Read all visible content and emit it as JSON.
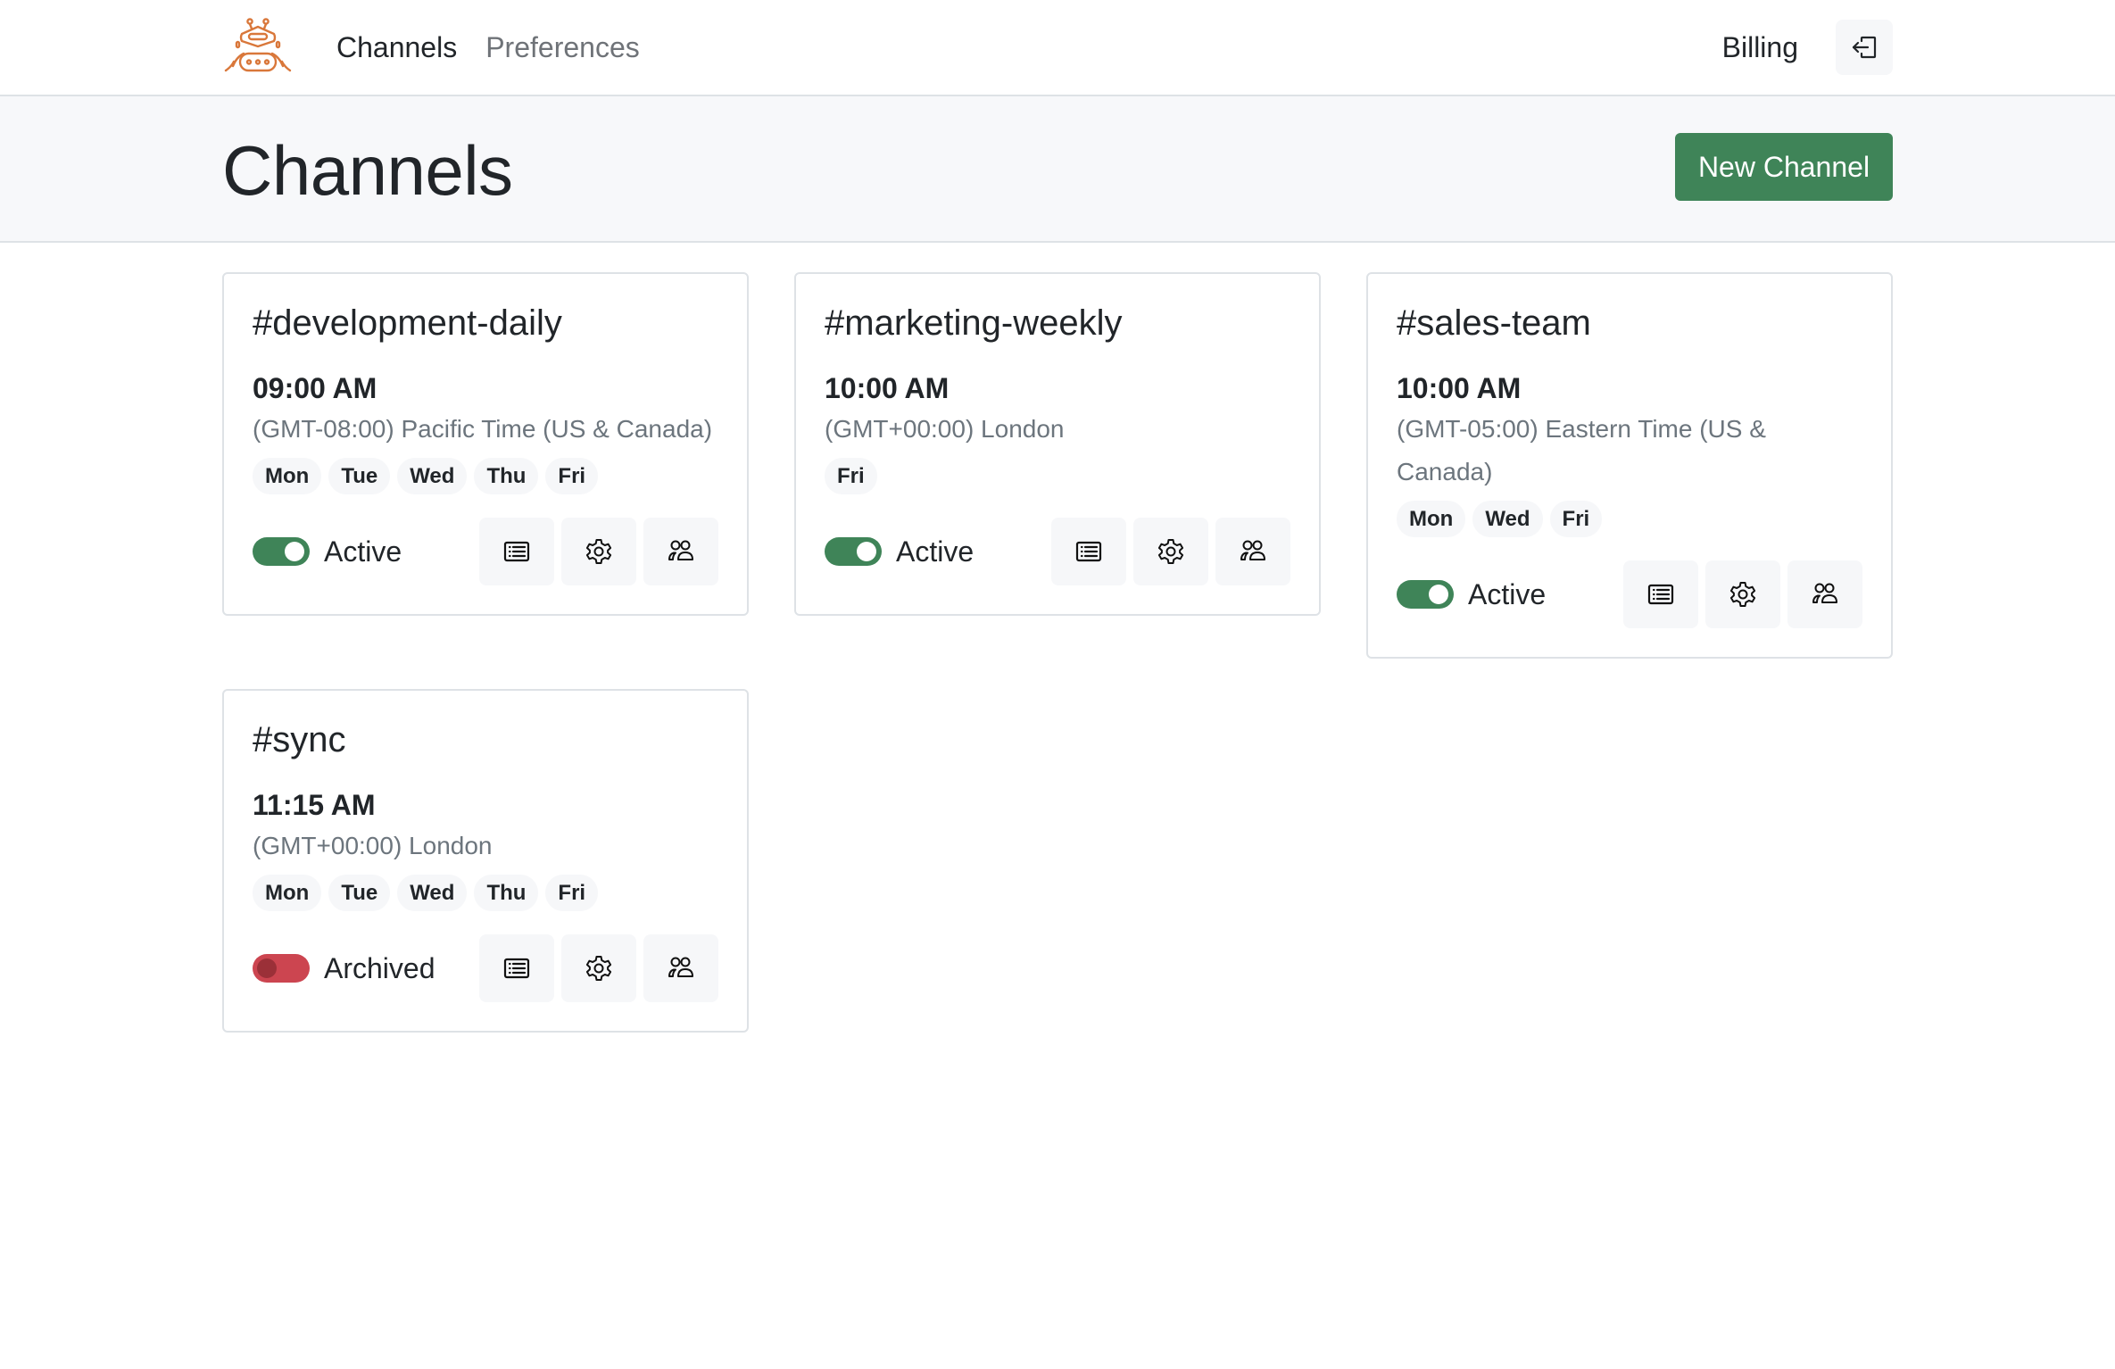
{
  "nav": {
    "logo_icon": "robot-icon",
    "links": [
      {
        "label": "Channels",
        "active": true
      },
      {
        "label": "Preferences",
        "active": false
      }
    ],
    "billing_label": "Billing",
    "logout_icon": "logout-icon"
  },
  "header": {
    "title": "Channels",
    "new_button_label": "New Channel"
  },
  "colors": {
    "accent_green": "#3f8458",
    "archived_red": "#cc4550",
    "logo_orange": "#d9773a"
  },
  "channels": [
    {
      "name": "#development-daily",
      "time": "09:00 AM",
      "timezone": "(GMT-08:00) Pacific Time (US & Canada)",
      "days": [
        "Mon",
        "Tue",
        "Wed",
        "Thu",
        "Fri"
      ],
      "status": "Active",
      "active": true
    },
    {
      "name": "#marketing-weekly",
      "time": "10:00 AM",
      "timezone": "(GMT+00:00) London",
      "days": [
        "Fri"
      ],
      "status": "Active",
      "active": true
    },
    {
      "name": "#sales-team",
      "time": "10:00 AM",
      "timezone": "(GMT-05:00) Eastern Time (US & Canada)",
      "days": [
        "Mon",
        "Wed",
        "Fri"
      ],
      "status": "Active",
      "active": true
    },
    {
      "name": "#sync",
      "time": "11:15 AM",
      "timezone": "(GMT+00:00) London",
      "days": [
        "Mon",
        "Tue",
        "Wed",
        "Thu",
        "Fri"
      ],
      "status": "Archived",
      "active": false
    }
  ],
  "card_actions": [
    {
      "icon": "list-icon",
      "name": "logs-button"
    },
    {
      "icon": "gear-icon",
      "name": "settings-button"
    },
    {
      "icon": "people-icon",
      "name": "members-button"
    }
  ]
}
